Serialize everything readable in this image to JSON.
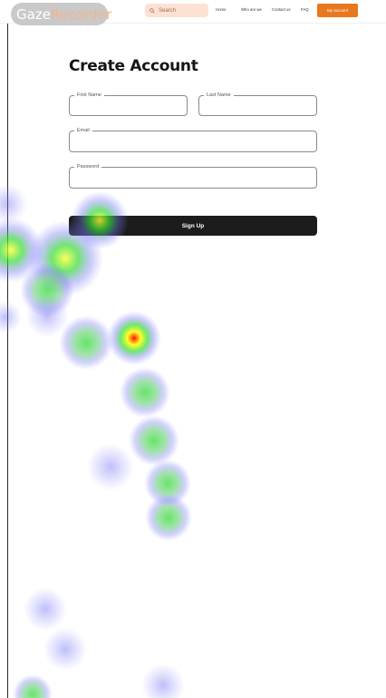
{
  "header": {
    "brand_part1": "Gaze",
    "brand_part2": "Recorder",
    "search_placeholder": "Search",
    "nav": [
      "Home",
      "Who are we",
      "Contact us",
      "FAQ"
    ],
    "account_button": "My account",
    "accent_color": "#e8781f"
  },
  "form": {
    "title": "Create Account",
    "first_name_label": "First Name",
    "last_name_label": "Last Name",
    "email_label": "Email",
    "password_label": "Password",
    "submit_label": "Sign Up"
  },
  "icons": {
    "search": "search-icon"
  }
}
